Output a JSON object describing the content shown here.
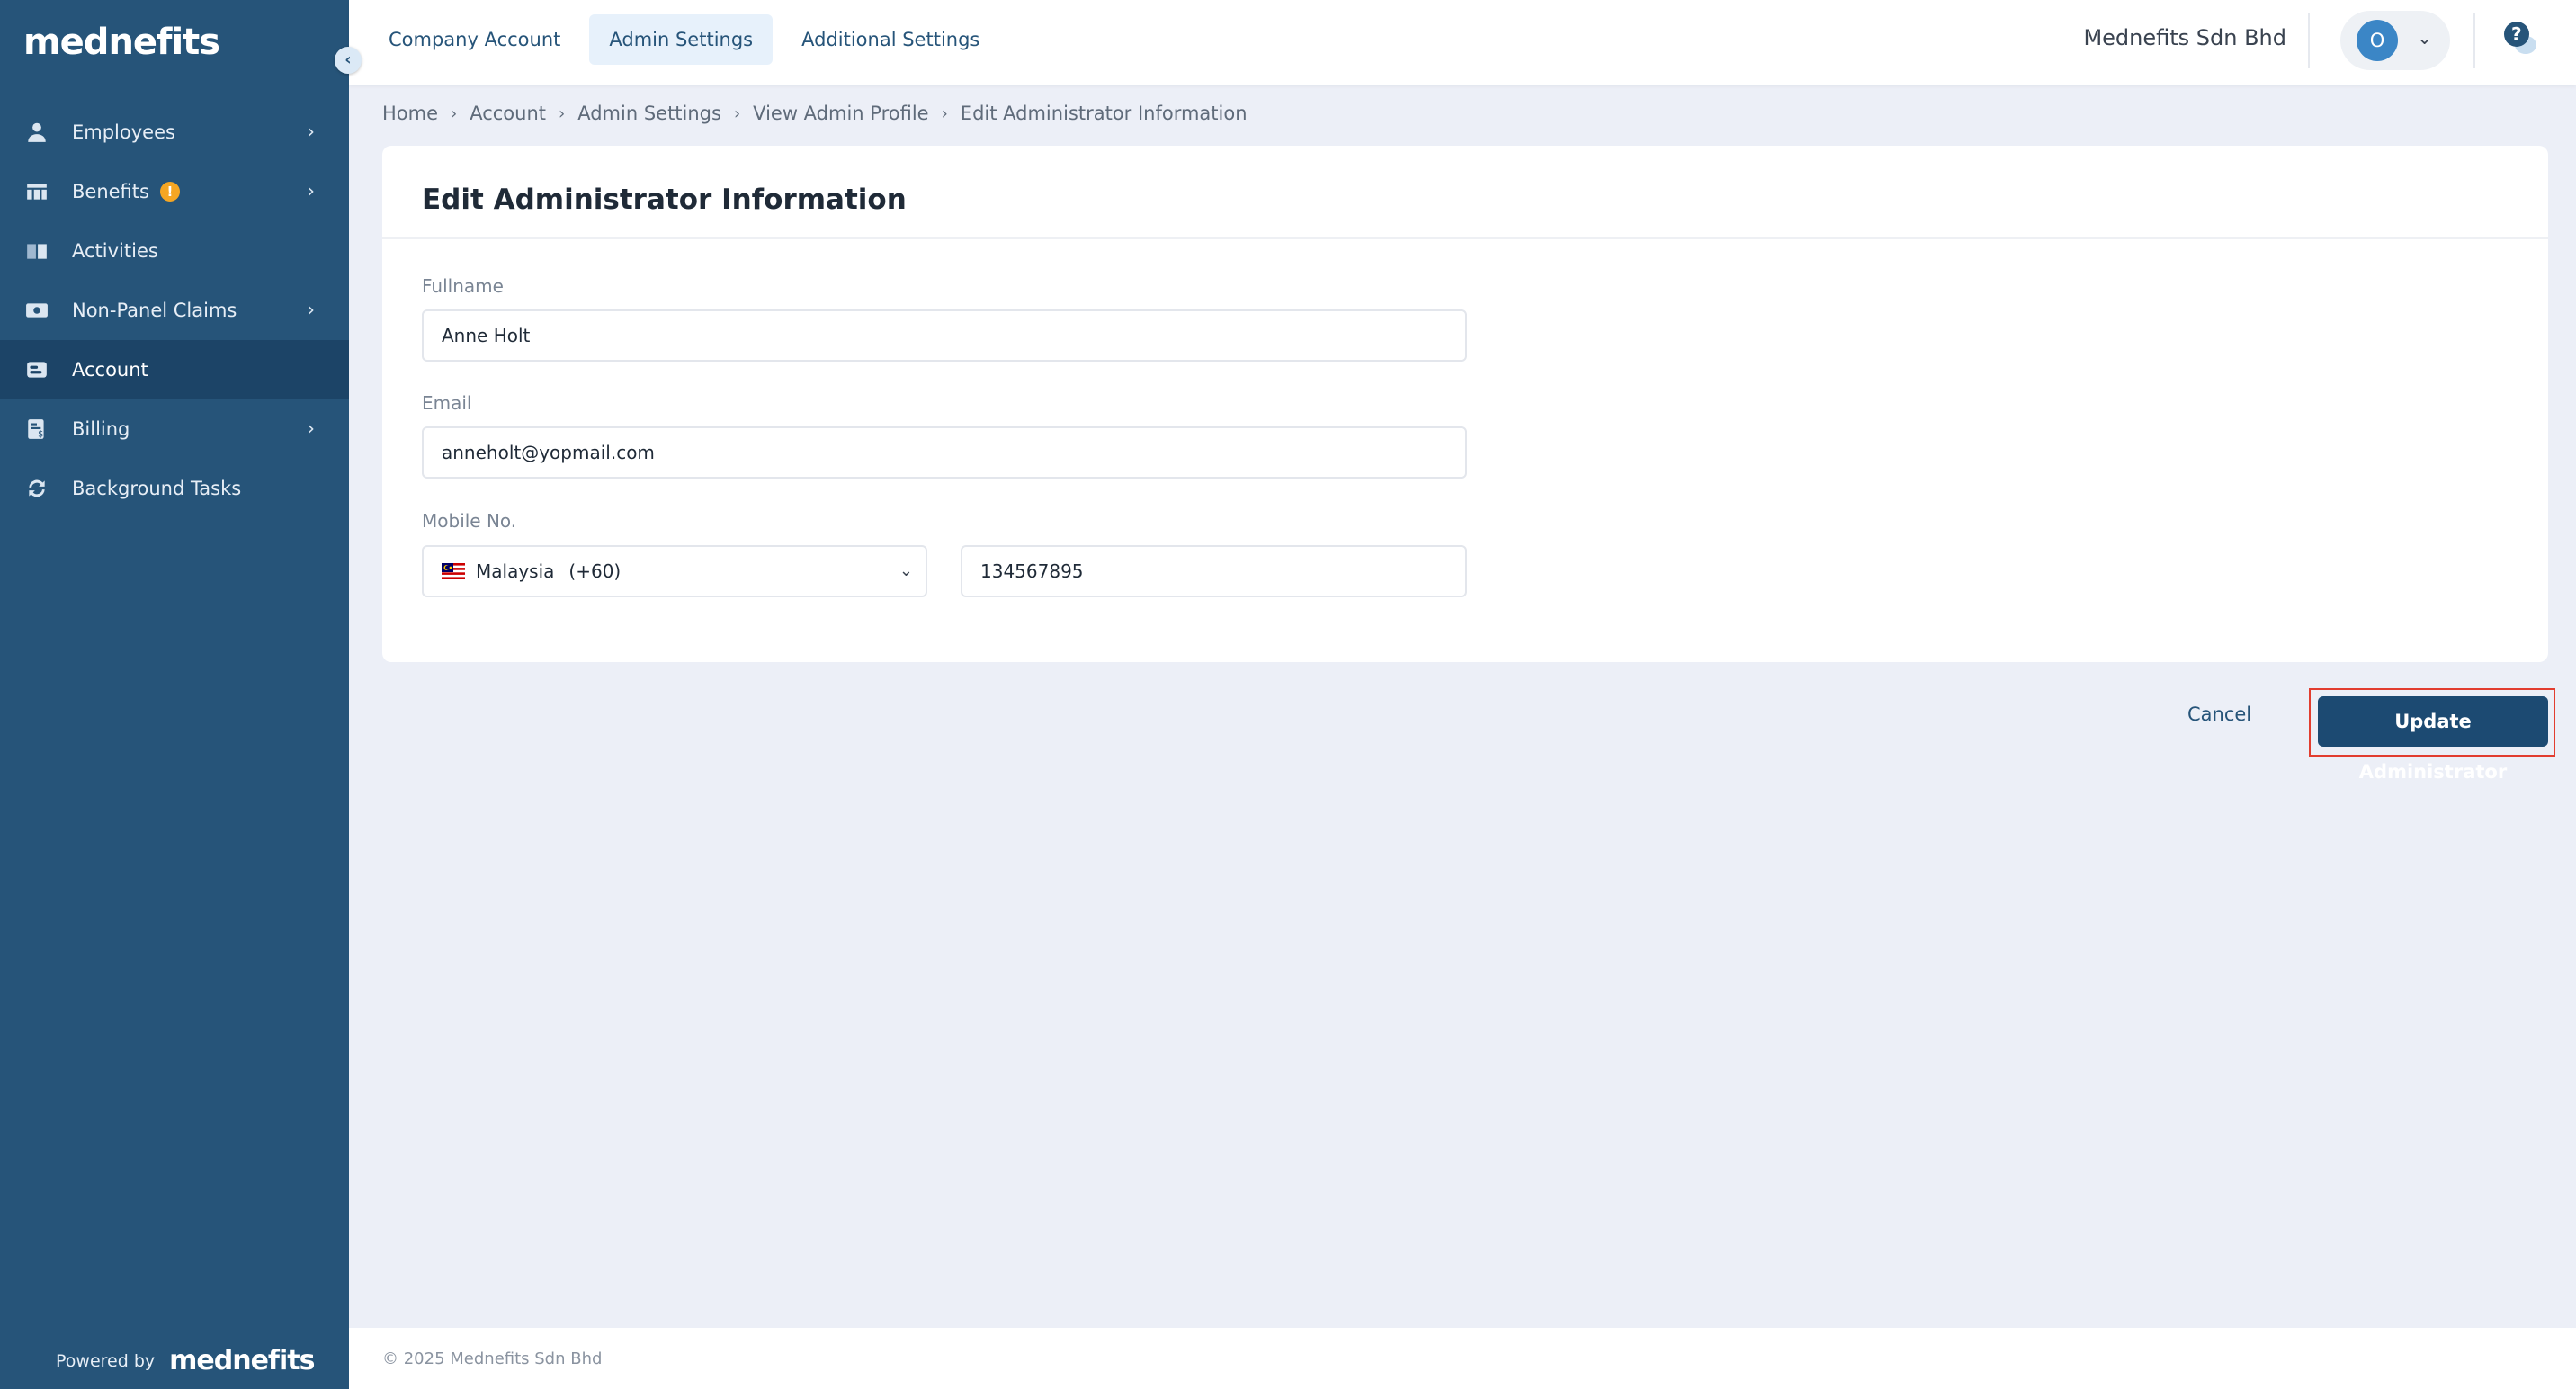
{
  "sidebar": {
    "brand": "mednefits",
    "items": [
      {
        "label": "Employees",
        "icon": "person-icon",
        "chevron": true
      },
      {
        "label": "Benefits",
        "icon": "table-icon",
        "chevron": true,
        "badge": "!"
      },
      {
        "label": "Activities",
        "icon": "book-icon",
        "chevron": false
      },
      {
        "label": "Non-Panel Claims",
        "icon": "cash-icon",
        "chevron": true
      },
      {
        "label": "Account",
        "icon": "id-card-icon",
        "chevron": false,
        "active": true
      },
      {
        "label": "Billing",
        "icon": "invoice-icon",
        "chevron": true
      },
      {
        "label": "Background Tasks",
        "icon": "sync-icon",
        "chevron": false
      }
    ],
    "powered_by_label": "Powered by",
    "powered_by_brand": "mednefits"
  },
  "topbar": {
    "tabs": [
      {
        "label": "Company Account",
        "active": false
      },
      {
        "label": "Admin Settings",
        "active": true
      },
      {
        "label": "Additional Settings",
        "active": false
      }
    ],
    "company_name": "Mednefits Sdn Bhd",
    "avatar_initial": "O"
  },
  "breadcrumb": [
    "Home",
    "Account",
    "Admin Settings",
    "View Admin Profile",
    "Edit Administrator Information"
  ],
  "form": {
    "title": "Edit Administrator Information",
    "fullname_label": "Fullname",
    "fullname_value": "Anne Holt",
    "email_label": "Email",
    "email_value": "anneholt@yopmail.com",
    "mobile_label": "Mobile No.",
    "country_name": "Malaysia",
    "country_code": "(+60)",
    "mobile_value": "134567895"
  },
  "actions": {
    "cancel_label": "Cancel",
    "update_label": "Update Administrator"
  },
  "footer": {
    "copyright": "© 2025 Mednefits Sdn Bhd"
  },
  "colors": {
    "sidebar": "#265479",
    "sidebar_active": "#1c4467",
    "primary_button": "#1c4a72",
    "highlight_frame": "#e23d2f",
    "warning_badge": "#f5a623"
  }
}
